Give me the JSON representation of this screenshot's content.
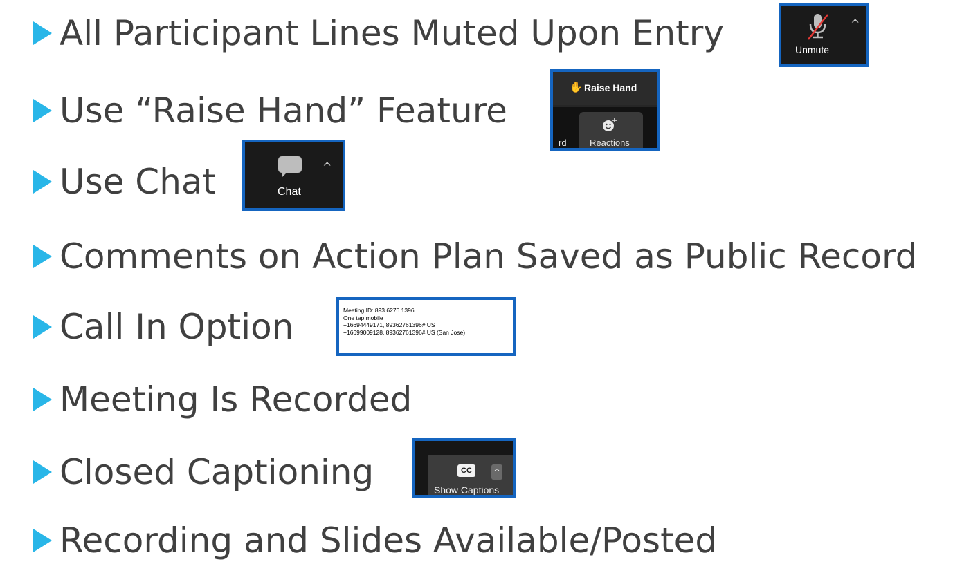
{
  "bullets": [
    {
      "text": "All Participant Lines Muted Upon Entry"
    },
    {
      "text": "Use “Raise Hand” Feature"
    },
    {
      "text": "Use Chat"
    },
    {
      "text": "Comments on Action Plan Saved as Public Record"
    },
    {
      "text": "Call In Option"
    },
    {
      "text": "Meeting Is Recorded"
    },
    {
      "text": "Closed Captioning"
    },
    {
      "text": "Recording and Slides Available/Posted"
    }
  ],
  "screenshots": {
    "unmute": {
      "label": "Unmute",
      "icon": "muted-microphone-icon"
    },
    "raise_hand": {
      "label": "Raise Hand",
      "reactions_label": "Reactions",
      "partial_label": "rd",
      "icon": "hand-icon"
    },
    "chat": {
      "label": "Chat",
      "icon": "speech-bubble-icon"
    },
    "call_in": {
      "lines": [
        "Meeting ID: 893 6276 1396",
        "One tap mobile",
        "+16694449171,,89362761396# US",
        "+16699009128,,89362761396# US (San Jose)"
      ]
    },
    "captions": {
      "label": "Show Captions",
      "cc_badge": "CC"
    }
  },
  "colors": {
    "bullet_arrow": "#29b6e8",
    "screenshot_border": "#1565c0",
    "text": "#404040"
  }
}
